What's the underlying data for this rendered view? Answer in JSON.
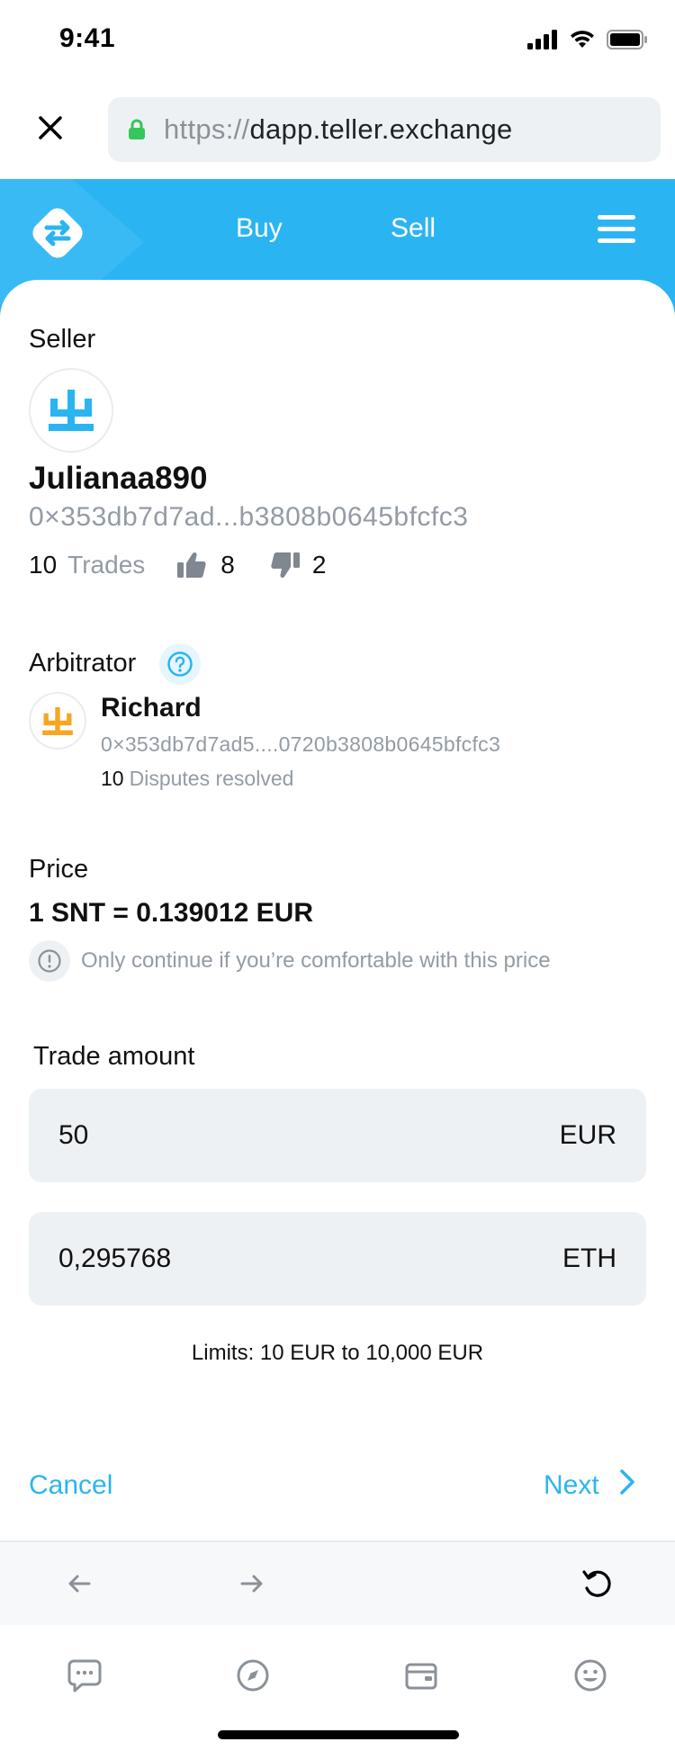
{
  "status_bar": {
    "time": "9:41"
  },
  "browser": {
    "url_protocol": "https://",
    "url_host": "dapp.teller.exchange"
  },
  "header": {
    "nav_buy": "Buy",
    "nav_sell": "Sell"
  },
  "seller": {
    "section_label": "Seller",
    "name": "Julianaa890",
    "address": "0×353db7d7ad...b3808b0645bfcfc3",
    "trades_count": "10",
    "trades_label": "Trades",
    "thumbs_up": "8",
    "thumbs_down": "2"
  },
  "arbitrator": {
    "section_label": "Arbitrator",
    "name": "Richard",
    "address": "0×353db7d7ad5....0720b3808b0645bfcfc3",
    "disputes_count": "10",
    "disputes_label": "Disputes resolved"
  },
  "price": {
    "section_label": "Price",
    "value": "1 SNT = 0.139012 EUR",
    "note": "Only continue if you’re comfortable with this price"
  },
  "trade": {
    "section_label": "Trade amount",
    "fiat_value": "50",
    "fiat_unit": "EUR",
    "crypto_value": "0,295768",
    "crypto_unit": "ETH",
    "limits": "Limits: 10 EUR to 10,000 EUR"
  },
  "actions": {
    "cancel": "Cancel",
    "next": "Next"
  },
  "colors": {
    "brand_blue": "#2bb4f2",
    "seller_avatar": "#2bb4f2",
    "arbitrator_avatar": "#f6a623",
    "muted_text": "#939ba5",
    "field_bg": "#eef1f4"
  },
  "icons": {
    "close": "close-icon",
    "lock": "lock-icon",
    "logo": "swap-arrows-logo",
    "menu": "hamburger-icon",
    "help": "question-icon",
    "info": "exclamation-icon",
    "thumbs_up": "thumbs-up-icon",
    "thumbs_down": "thumbs-down-icon",
    "back": "arrow-left-icon",
    "forward": "arrow-right-icon",
    "reload": "reload-icon",
    "tabs": [
      "chat-icon",
      "compass-icon",
      "wallet-icon",
      "smiley-icon"
    ]
  }
}
